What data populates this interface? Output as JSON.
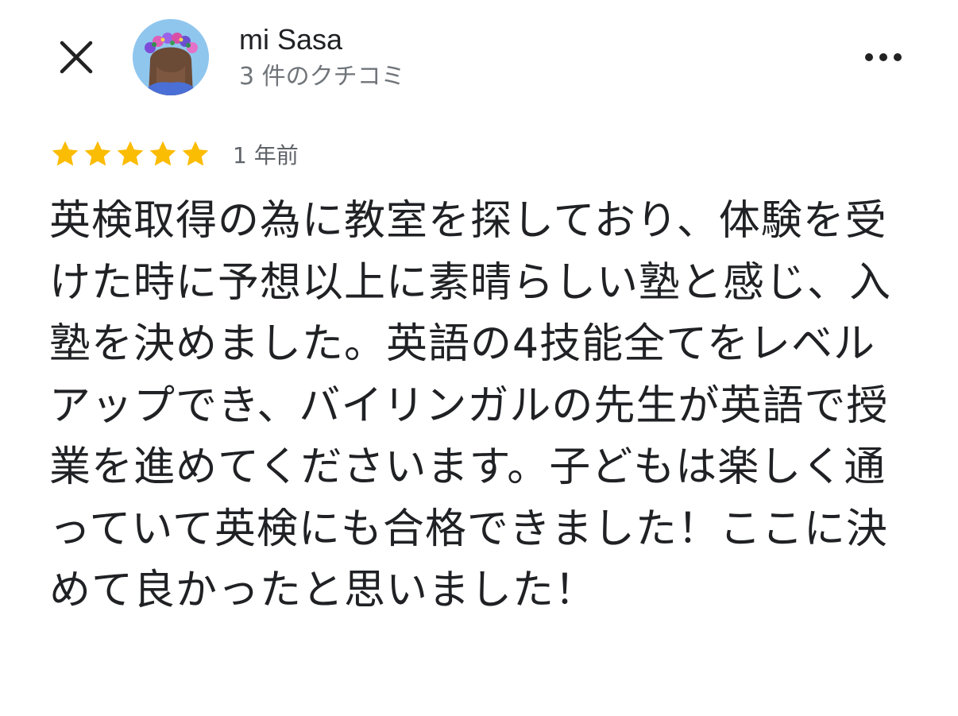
{
  "header": {
    "close_icon": "close-icon",
    "user_name": "mi Sasa",
    "review_count": "3 件のクチコミ",
    "more_icon": "more-horizontal-icon"
  },
  "review": {
    "rating": 5,
    "rating_max": 5,
    "star_color": "#fbbc04",
    "date": "1 年前",
    "text": "英検取得の為に教室を探しており、体験を受けた時に予想以上に素晴らしい塾と感じ、入塾を決めました。英語の4技能全てをレベルアップでき、バイリンガルの先生が英語で授業を進めてくださいます。子どもは楽しく通っていて英検にも合格できました！ここに決めて良かったと思いました！"
  }
}
